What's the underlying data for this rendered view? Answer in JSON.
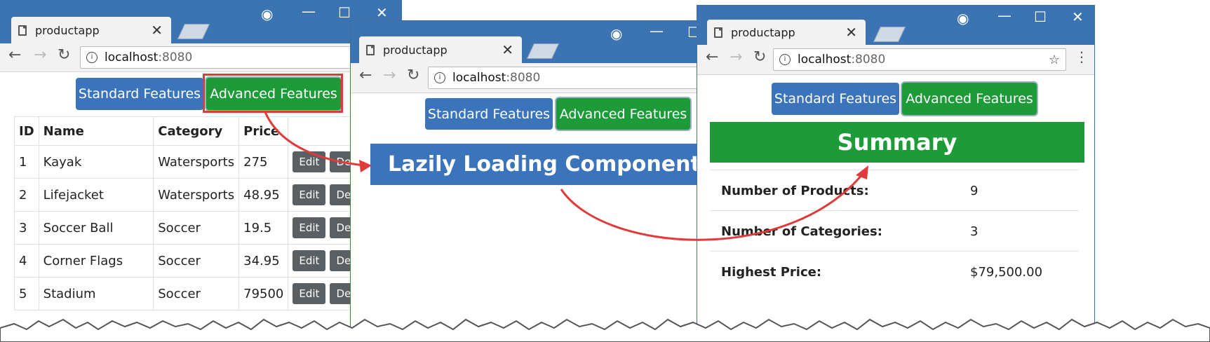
{
  "windows": [
    {
      "tab_title": "productapp",
      "address": {
        "host": "localhost",
        "port": ":8080"
      },
      "nav": {
        "standard": "Standard Features",
        "advanced": "Advanced Features"
      },
      "table": {
        "headers": [
          "ID",
          "Name",
          "Category",
          "Price",
          ""
        ],
        "rows": [
          [
            "1",
            "Kayak",
            "Watersports",
            "275"
          ],
          [
            "2",
            "Lifejacket",
            "Watersports",
            "48.95"
          ],
          [
            "3",
            "Soccer Ball",
            "Soccer",
            "19.5"
          ],
          [
            "4",
            "Corner Flags",
            "Soccer",
            "34.95"
          ],
          [
            "5",
            "Stadium",
            "Soccer",
            "79500"
          ]
        ],
        "edit_label": "Edit",
        "delete_label": "Delete"
      }
    },
    {
      "tab_title": "productapp",
      "address": {
        "host": "localhost",
        "port": ":8080"
      },
      "nav": {
        "standard": "Standard Features",
        "advanced": "Advanced Features"
      },
      "loading_text": "Lazily Loading Component..."
    },
    {
      "tab_title": "productapp",
      "address": {
        "host": "localhost",
        "port": ":8080"
      },
      "nav": {
        "standard": "Standard Features",
        "advanced": "Advanced Features"
      },
      "summary": {
        "title": "Summary",
        "rows": [
          {
            "label": "Number of Products:",
            "value": "9"
          },
          {
            "label": "Number of Categories:",
            "value": "3"
          },
          {
            "label": "Highest Price:",
            "value": "$79,500.00"
          }
        ]
      }
    }
  ],
  "colors": {
    "primary": "#3b74bb",
    "success": "#1e9b39",
    "titlebar": "#3b73b3",
    "highlight": "#e03a3a",
    "arrow": "#e03a3a"
  }
}
